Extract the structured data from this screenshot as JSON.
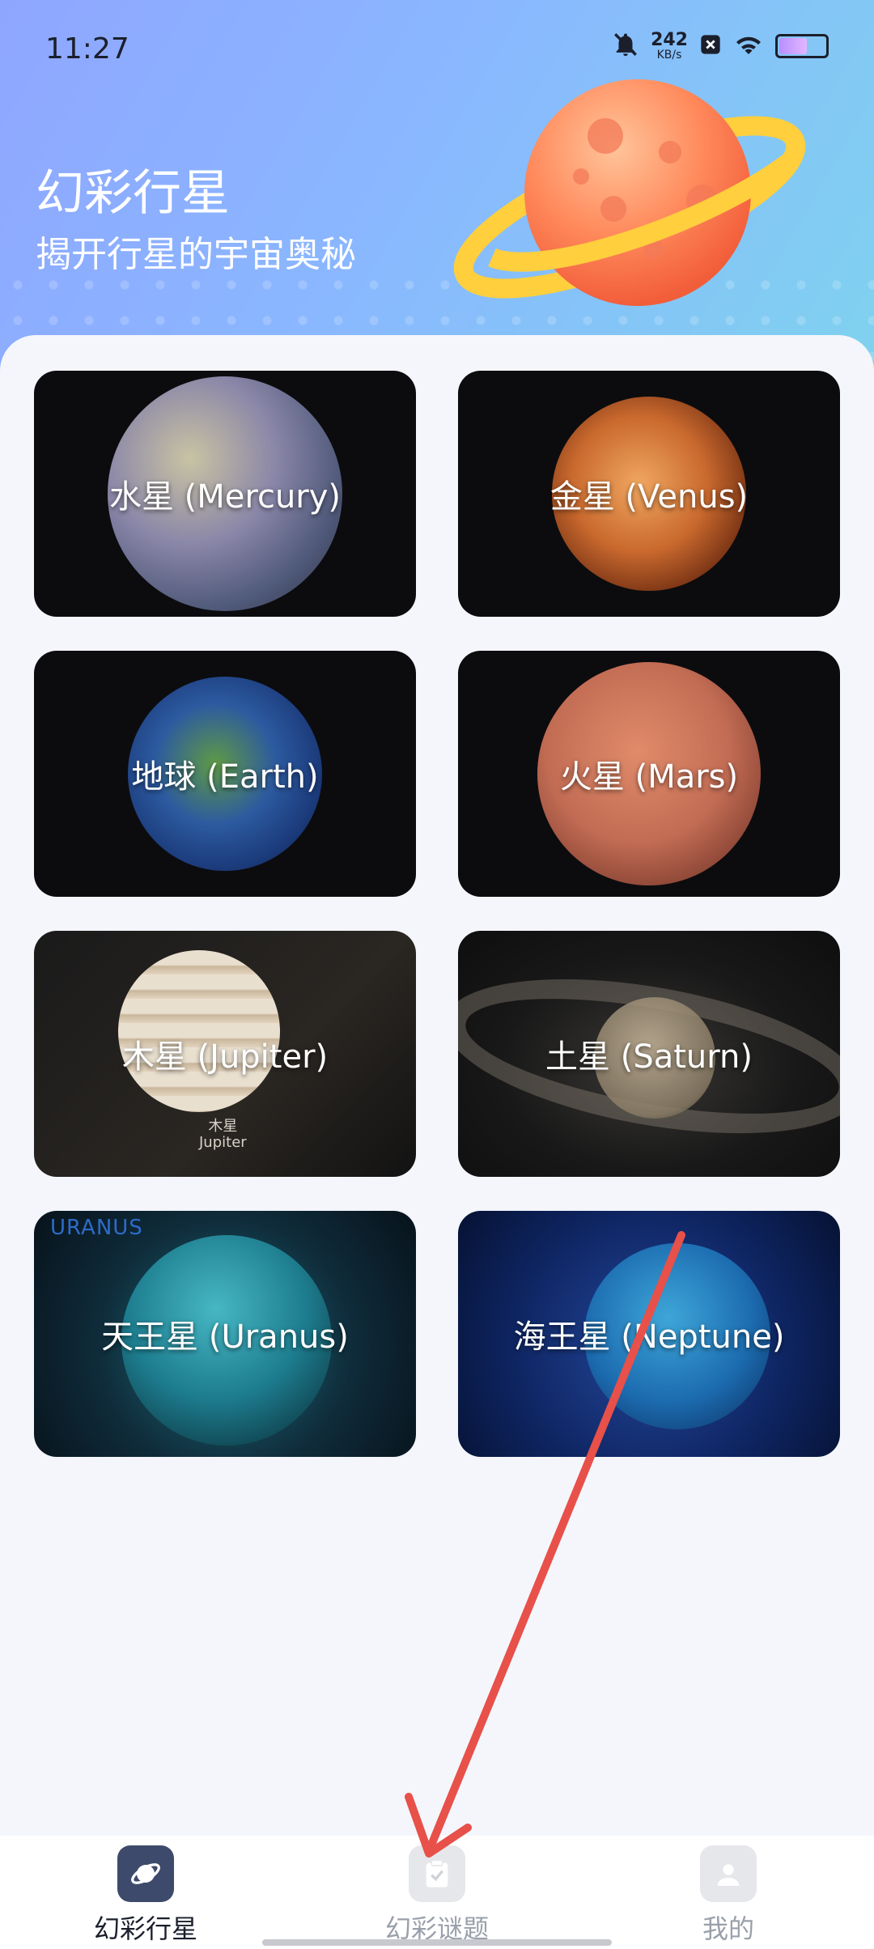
{
  "status_bar": {
    "time": "11:27",
    "net_speed_value": "242",
    "net_speed_unit": "KB/s",
    "icons": [
      "bell-off-icon",
      "close-box-icon",
      "wifi-icon",
      "battery-icon"
    ]
  },
  "header": {
    "title": "幻彩行星",
    "subtitle": "揭开行星的宇宙奥秘"
  },
  "planets": [
    {
      "label": "水星 (Mercury)"
    },
    {
      "label": "金星 (Venus)"
    },
    {
      "label": "地球 (Earth)"
    },
    {
      "label": "火星 (Mars)"
    },
    {
      "label": "木星 (Jupiter)",
      "image_caption_cn": "木星",
      "image_caption_en": "Jupiter"
    },
    {
      "label": "土星 (Saturn)"
    },
    {
      "label": "天王星 (Uranus)",
      "image_caption": "URANUS"
    },
    {
      "label": "海王星 (Neptune)"
    }
  ],
  "bottom_nav": {
    "items": [
      {
        "label": "幻彩行星",
        "icon": "planet-icon",
        "active": true
      },
      {
        "label": "幻彩谜题",
        "icon": "clipboard-check-icon",
        "active": false
      },
      {
        "label": "我的",
        "icon": "user-icon",
        "active": false
      }
    ]
  },
  "colors": {
    "accent": "#3d4a6b",
    "arrow": "#e8504a",
    "header_start": "#8fa6ff",
    "header_end": "#7fd2ef"
  }
}
